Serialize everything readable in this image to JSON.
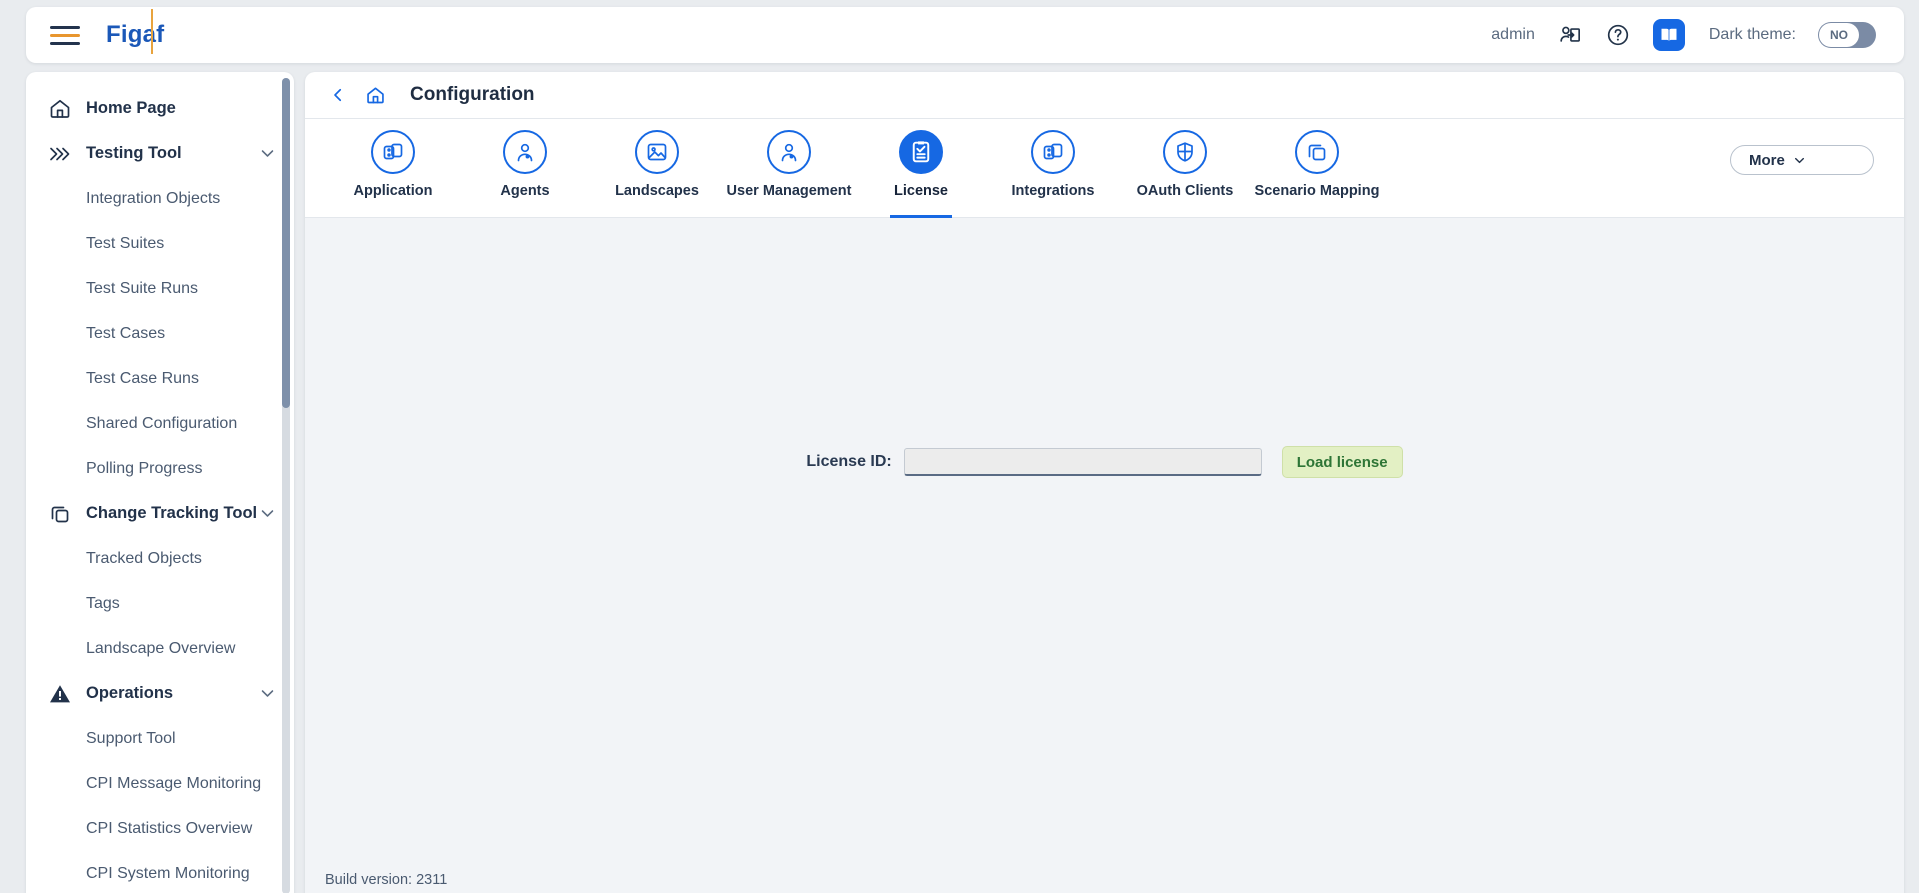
{
  "header": {
    "menu_icon": "hamburger-icon",
    "brand": "Figaf",
    "user": "admin",
    "user_switch_icon": "user-switch-icon",
    "help_icon": "question-circle-icon",
    "docs_icon": "book-icon",
    "dark_theme_label": "Dark theme:",
    "dark_theme_value": "NO",
    "accent_blue": "#1668e3",
    "accent_orange": "#e8a33d"
  },
  "sidebar": {
    "items": [
      {
        "label": "Home Page",
        "type": "group",
        "icon": "home-icon",
        "expandable": false
      },
      {
        "label": "Testing Tool",
        "type": "group",
        "icon": "chevrons-right-icon",
        "expandable": true
      },
      {
        "label": "Integration Objects",
        "type": "item"
      },
      {
        "label": "Test Suites",
        "type": "item"
      },
      {
        "label": "Test Suite Runs",
        "type": "item"
      },
      {
        "label": "Test Cases",
        "type": "item"
      },
      {
        "label": "Test Case Runs",
        "type": "item"
      },
      {
        "label": "Shared Configuration",
        "type": "item"
      },
      {
        "label": "Polling Progress",
        "type": "item"
      },
      {
        "label": "Change Tracking Tool",
        "type": "group",
        "icon": "copy-icon",
        "expandable": true
      },
      {
        "label": "Tracked Objects",
        "type": "item"
      },
      {
        "label": "Tags",
        "type": "item"
      },
      {
        "label": "Landscape Overview",
        "type": "item"
      },
      {
        "label": "Operations",
        "type": "group",
        "icon": "warning-triangle-icon",
        "expandable": true
      },
      {
        "label": "Support Tool",
        "type": "item"
      },
      {
        "label": "CPI Message Monitoring",
        "type": "item"
      },
      {
        "label": "CPI Statistics Overview",
        "type": "item"
      },
      {
        "label": "CPI System Monitoring",
        "type": "item"
      }
    ]
  },
  "breadcrumb": {
    "back_icon": "chevron-left-icon",
    "home_icon": "home-icon",
    "title": "Configuration"
  },
  "tabs": [
    {
      "label": "Application",
      "icon": "app-cards-icon",
      "active": false
    },
    {
      "label": "Agents",
      "icon": "person-badge-icon",
      "active": false
    },
    {
      "label": "Landscapes",
      "icon": "image-icon",
      "active": false
    },
    {
      "label": "User Management",
      "icon": "person-badge-icon",
      "active": false
    },
    {
      "label": "License",
      "icon": "clipboard-check-icon",
      "active": true
    },
    {
      "label": "Integrations",
      "icon": "app-cards-icon",
      "active": false
    },
    {
      "label": "OAuth Clients",
      "icon": "shield-icon",
      "active": false
    },
    {
      "label": "Scenario Mapping",
      "icon": "copy-icon",
      "active": false
    }
  ],
  "more_button": {
    "label": "More",
    "icon": "chevron-down-icon"
  },
  "license_panel": {
    "field_label": "License ID:",
    "field_value": "",
    "field_placeholder": "",
    "load_button": "Load license",
    "load_button_bg": "#e3f0c4",
    "load_button_color": "#2e7536"
  },
  "footer": {
    "build_version": "Build version: 2311"
  }
}
